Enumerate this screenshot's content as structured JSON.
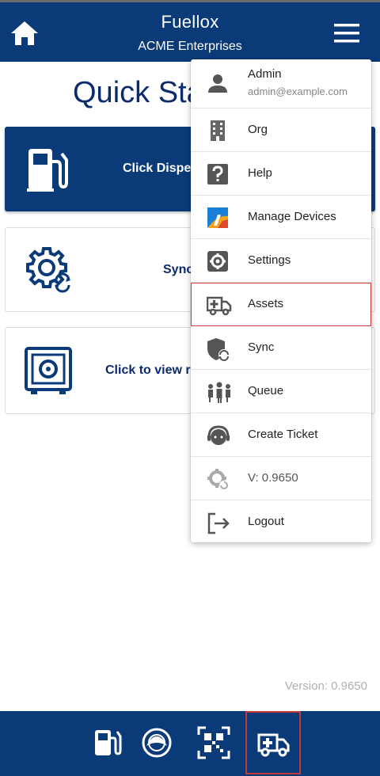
{
  "header": {
    "title": "Fuellox",
    "subtitle": "ACME Enterprises"
  },
  "main": {
    "heading": "Quick Sta",
    "cards": [
      {
        "text": "Click Dispe"
      },
      {
        "text": "Sync"
      },
      {
        "text": "Click to view r"
      }
    ],
    "version": "Version: 0.9650"
  },
  "menu": {
    "user": {
      "name": "Admin",
      "email": "admin@example.com"
    },
    "items": [
      {
        "label": "Org",
        "icon": "building-icon"
      },
      {
        "label": "Help",
        "icon": "help-icon"
      },
      {
        "label": "Manage Devices",
        "icon": "device-logo-icon"
      },
      {
        "label": "Settings",
        "icon": "gear-icon"
      },
      {
        "label": "Assets",
        "icon": "ambulance-icon"
      },
      {
        "label": "Sync",
        "icon": "shield-sync-icon"
      },
      {
        "label": "Queue",
        "icon": "people-queue-icon"
      },
      {
        "label": "Create Ticket",
        "icon": "support-agent-icon"
      },
      {
        "label": "V: 0.9650",
        "icon": "gear-refresh-icon"
      },
      {
        "label": "Logout",
        "icon": "logout-icon"
      }
    ],
    "selected": "Assets"
  },
  "bottom_nav": [
    {
      "icon": "fuel-pump-icon"
    },
    {
      "icon": "tank-icon"
    },
    {
      "icon": "qr-code-icon"
    },
    {
      "icon": "ambulance-icon"
    }
  ],
  "colors": {
    "primary": "#0b3a78",
    "title_text": "#0b2b6d",
    "selection_border": "#c23a3a"
  }
}
